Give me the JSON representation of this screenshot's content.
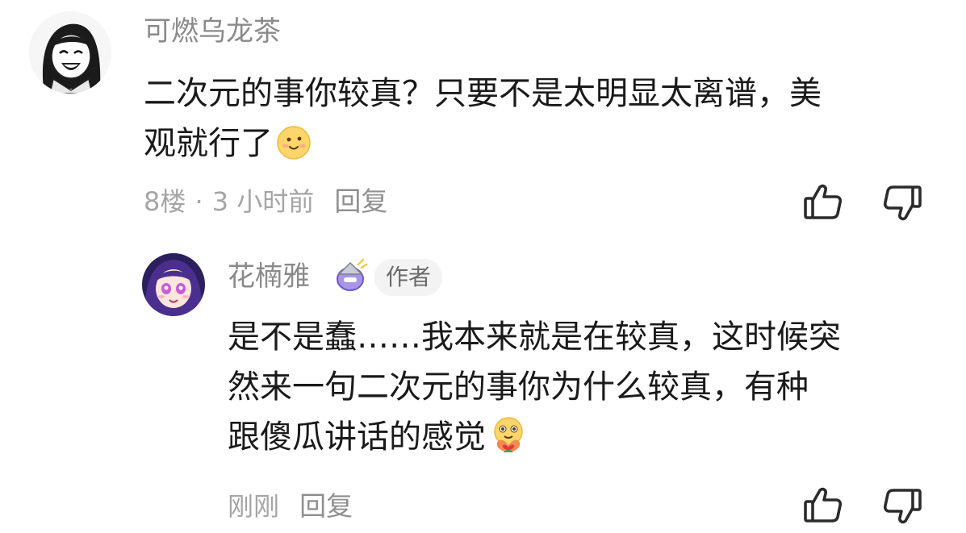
{
  "comment": {
    "username": "可燃乌龙茶",
    "line1": "二次元的事你较真？只要不是太明显太离谱，美",
    "line2": "观就行了",
    "emoji": "smile-emoji",
    "floor": "8楼",
    "separator": "·",
    "time": "3 小时前",
    "reply_label": "回复"
  },
  "reply": {
    "username": "花楠雅",
    "author_badge": "作者",
    "line1": "是不是蠢……我本来就是在较真，这时候突",
    "line2": "然来一句二次元的事你为什么较真，有种",
    "line3": "跟傻瓜讲话的感觉",
    "emoji": "heart-hands-emoji",
    "time": "刚刚",
    "reply_label": "回复"
  }
}
